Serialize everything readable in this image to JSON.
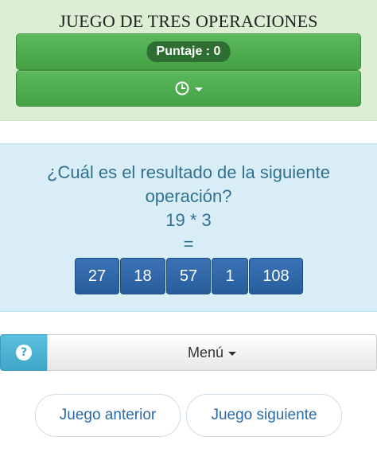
{
  "header": {
    "title": "JUEGO DE TRES OPERACIONES",
    "score_label": "Puntaje : 0",
    "timer_icon": "clock-icon",
    "background": "#dcefd4",
    "bar_color": "#5cb85c"
  },
  "question": {
    "line1": "¿Cuál es el resultado de la siguiente",
    "line2": "operación?",
    "expression": "19 * 3",
    "equals": "=",
    "answers": [
      "27",
      "18",
      "57",
      "1",
      "108"
    ],
    "text_color": "#31708f",
    "background": "#d9edf7",
    "answer_color": "#2f67a8"
  },
  "menu": {
    "help_icon": "question-circle-icon",
    "label": "Menú"
  },
  "nav": {
    "prev_label": "Juego anterior",
    "next_label": "Juego siguiente"
  }
}
